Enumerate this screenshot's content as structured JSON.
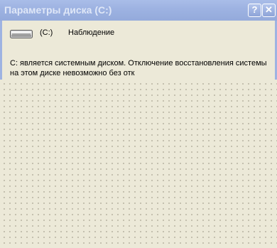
{
  "window": {
    "title": "Параметры диска (C:)",
    "help_glyph": "?",
    "close_glyph": "✕"
  },
  "drive": {
    "icon": "hard-drive-icon",
    "label": "(C:)",
    "status": "Наблюдение"
  },
  "message": {
    "line1": "C: является системным диском. Отключение восстановления системы",
    "line2": "на этом диске невозможно без отк"
  },
  "colors": {
    "titlebar": "#9eb3e2",
    "window_bg": "#ece9d8",
    "dots": "#b9b4a3"
  }
}
